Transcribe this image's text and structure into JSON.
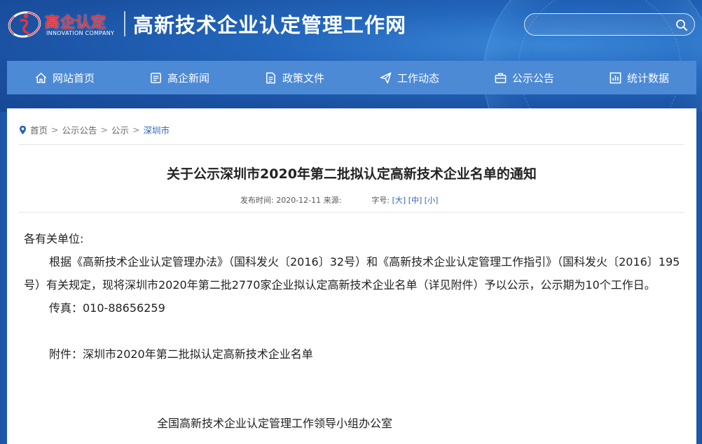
{
  "header": {
    "logo_cn": "高企认定",
    "logo_en": "INNOVATION COMPANY",
    "site_title": "高新技术企业认定管理工作网",
    "search_placeholder": "",
    "search_value": ""
  },
  "nav": {
    "items": [
      {
        "label": "网站首页",
        "icon": "home-icon"
      },
      {
        "label": "高企新闻",
        "icon": "news-icon"
      },
      {
        "label": "政策文件",
        "icon": "document-icon"
      },
      {
        "label": "工作动态",
        "icon": "paper-plane-icon"
      },
      {
        "label": "公示公告",
        "icon": "briefcase-icon"
      },
      {
        "label": "统计数据",
        "icon": "chart-icon"
      }
    ]
  },
  "breadcrumb": {
    "items": [
      "首页",
      "公示公告",
      "公示",
      "深圳市"
    ],
    "separator": ">"
  },
  "article": {
    "title": "关于公示深圳市2020年第二批拟认定高新技术企业名单的通知",
    "publish_label": "发布时间:",
    "publish_date": "2020-12-11",
    "source_label": "来源:",
    "source_value": "",
    "font_label": "字号:",
    "font_large": "[大]",
    "font_medium": "[中]",
    "font_small": "[小]",
    "greeting": "各有关单位:",
    "paragraph": "根据《高新技术企业认定管理办法》（国科发火〔2016〕32号）和《高新技术企业认定管理工作指引》（国科发火〔2016〕195号）有关规定，现将深圳市2020年第二批2770家企业拟认定高新技术企业名单（详见附件）予以公示，公示期为10个工作日。",
    "fax": "传真：010-88656259",
    "attachment_label": "附件：",
    "attachment_link": "深圳市2020年第二批拟认定高新技术企业名单",
    "signature": "全国高新技术企业认定管理工作领导小组办公室"
  },
  "colors": {
    "header_bg": "#1f55a8",
    "nav_bg": "#4c8ad6",
    "logo_red": "#e8343a",
    "link_blue": "#2a62b8"
  }
}
